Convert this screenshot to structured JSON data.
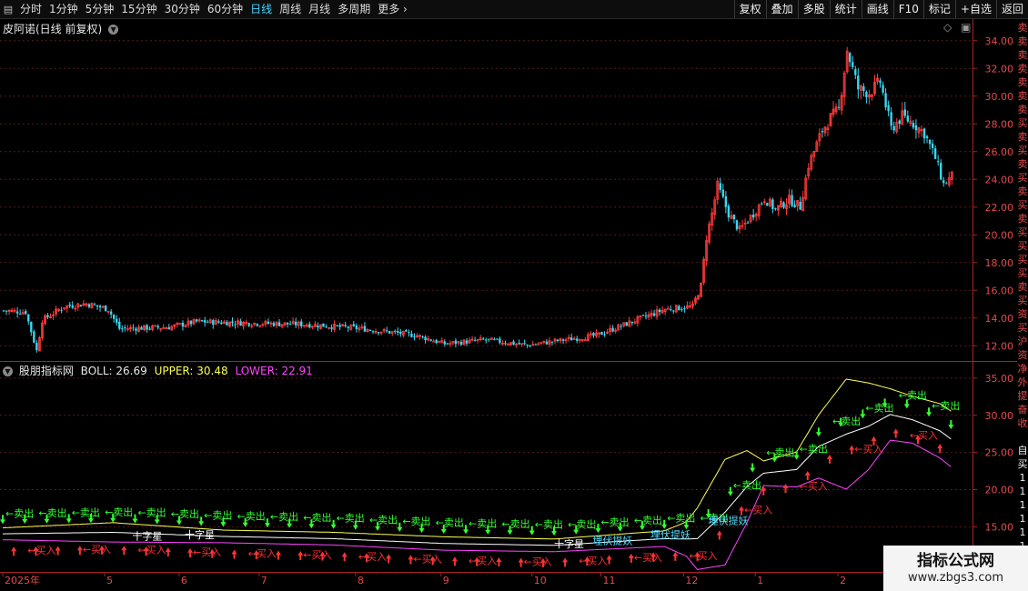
{
  "toolbar": {
    "periods": [
      {
        "label": "分时",
        "active": false
      },
      {
        "label": "1分钟",
        "active": false
      },
      {
        "label": "5分钟",
        "active": false
      },
      {
        "label": "15分钟",
        "active": false
      },
      {
        "label": "30分钟",
        "active": false
      },
      {
        "label": "60分钟",
        "active": false
      },
      {
        "label": "日线",
        "active": true
      },
      {
        "label": "周线",
        "active": false
      },
      {
        "label": "月线",
        "active": false
      },
      {
        "label": "多周期",
        "active": false
      },
      {
        "label": "更多",
        "active": false
      }
    ],
    "right_buttons": [
      "复权",
      "叠加",
      "多股",
      "统计",
      "画线",
      "F10",
      "标记",
      "+自选",
      "返回"
    ]
  },
  "main_panel": {
    "title": "皮阿诺(日线 前复权)",
    "y_ticks": [
      34.0,
      32.0,
      30.0,
      28.0,
      26.0,
      24.0,
      22.0,
      20.0,
      18.0,
      16.0,
      14.0,
      12.0
    ]
  },
  "indicator_panel": {
    "title": "股朋指标网",
    "boll_label": "BOLL:",
    "boll_value": "26.69",
    "upper_label": "UPPER:",
    "upper_value": "30.48",
    "lower_label": "LOWER:",
    "lower_value": "22.91",
    "y_ticks": [
      "35.00",
      "30.00",
      "25.00",
      "20.00",
      "15.00"
    ],
    "sell_text": "←卖出",
    "buy_text": "←买入",
    "cross_text": "十字星",
    "ambush_text": "埋伏提妖",
    "colors": {
      "boll": "#ffffff",
      "upper": "#ffff55",
      "lower": "#ff44ff",
      "sell": "#33ff33",
      "buy": "#ff3333",
      "ambush": "#55ddff"
    }
  },
  "date_axis": {
    "labels": [
      {
        "text": "2025年",
        "idx": 0
      },
      {
        "text": "5",
        "idx": 37
      },
      {
        "text": "6",
        "idx": 64
      },
      {
        "text": "7",
        "idx": 93
      },
      {
        "text": "8",
        "idx": 128
      },
      {
        "text": "9",
        "idx": 159
      },
      {
        "text": "10",
        "idx": 192
      },
      {
        "text": "11",
        "idx": 217
      },
      {
        "text": "12",
        "idx": 247
      },
      {
        "text": "1",
        "idx": 273
      },
      {
        "text": "2",
        "idx": 303
      }
    ]
  },
  "right_strip_chars": [
    "卖",
    "卖",
    "卖",
    "卖",
    "卖",
    "卖",
    "卖",
    "买",
    "卖",
    "买",
    "卖",
    "买",
    "卖",
    "买",
    "卖",
    "买",
    "买",
    "买",
    "买",
    "卖",
    "买",
    "资",
    "买",
    "沪",
    "资",
    "净",
    "外",
    "提",
    "奋",
    "收",
    "",
    "自",
    "买",
    "1",
    "1",
    "1",
    "1",
    "1",
    "1",
    "1"
  ],
  "watermark": {
    "line1": "指标公式网",
    "line2": "www.zbgs3.com"
  },
  "chart_data": {
    "type": "candlestick",
    "title": "皮阿诺(日线 前复权)",
    "ylim": [
      11.0,
      35.0
    ],
    "anchors": [
      [
        0,
        14.5
      ],
      [
        8,
        14.4
      ],
      [
        12,
        11.6
      ],
      [
        14,
        13.8
      ],
      [
        22,
        14.8
      ],
      [
        30,
        15.0
      ],
      [
        38,
        14.6
      ],
      [
        42,
        13.2
      ],
      [
        60,
        13.3
      ],
      [
        70,
        13.7
      ],
      [
        90,
        13.6
      ],
      [
        110,
        13.5
      ],
      [
        130,
        13.2
      ],
      [
        150,
        12.7
      ],
      [
        160,
        12.1
      ],
      [
        175,
        12.4
      ],
      [
        190,
        12.0
      ],
      [
        200,
        12.3
      ],
      [
        215,
        12.7
      ],
      [
        228,
        13.7
      ],
      [
        240,
        14.6
      ],
      [
        250,
        14.8
      ],
      [
        253,
        16.3
      ],
      [
        255,
        19.8
      ],
      [
        257,
        21.5
      ],
      [
        259,
        23.5
      ],
      [
        263,
        21.5
      ],
      [
        267,
        20.3
      ],
      [
        272,
        21.5
      ],
      [
        276,
        22.6
      ],
      [
        280,
        21.8
      ],
      [
        285,
        22.5
      ],
      [
        289,
        22.0
      ],
      [
        292,
        25.0
      ],
      [
        297,
        27.5
      ],
      [
        300,
        28.4
      ],
      [
        303,
        29.0
      ],
      [
        306,
        33.3
      ],
      [
        310,
        30.5
      ],
      [
        314,
        30.2
      ],
      [
        318,
        31.0
      ],
      [
        322,
        27.6
      ],
      [
        326,
        28.5
      ],
      [
        330,
        28.0
      ],
      [
        334,
        27.3
      ],
      [
        338,
        25.5
      ],
      [
        341,
        23.6
      ],
      [
        344,
        24.2
      ]
    ],
    "band_anchors": [
      [
        0,
        14.8,
        13.2
      ],
      [
        40,
        15.5,
        12.9
      ],
      [
        80,
        14.5,
        12.8
      ],
      [
        120,
        14.2,
        12.5
      ],
      [
        160,
        13.6,
        11.8
      ],
      [
        200,
        13.3,
        11.6
      ],
      [
        240,
        14.4,
        12.3
      ],
      [
        248,
        15.6,
        11.0
      ],
      [
        252,
        17.5,
        9.2
      ],
      [
        262,
        24.0,
        9.8
      ],
      [
        270,
        25.2,
        15.5
      ],
      [
        276,
        23.8,
        20.5
      ],
      [
        288,
        25.0,
        20.3
      ],
      [
        296,
        30.0,
        21.5
      ],
      [
        306,
        34.8,
        20.0
      ],
      [
        314,
        34.3,
        22.6
      ],
      [
        322,
        33.5,
        26.6
      ],
      [
        330,
        32.5,
        26.2
      ],
      [
        340,
        31.5,
        24.2
      ],
      [
        344,
        30.5,
        23.0
      ]
    ]
  }
}
